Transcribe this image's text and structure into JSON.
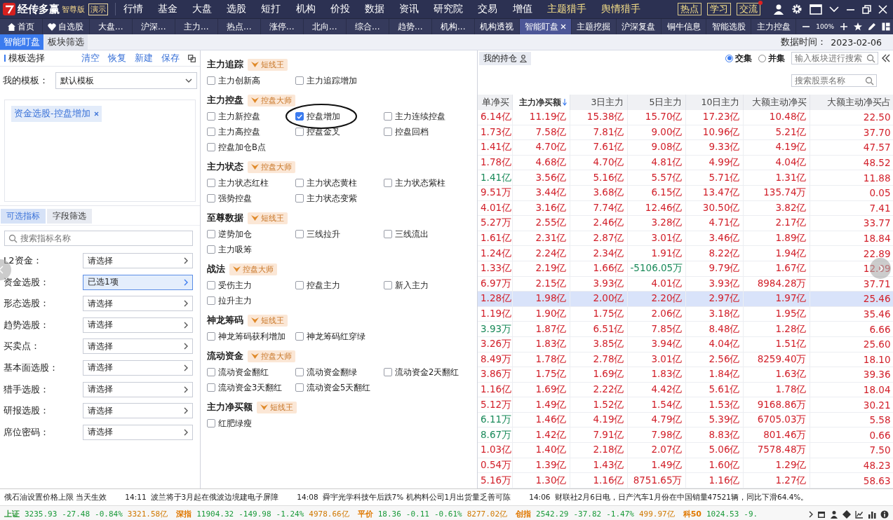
{
  "app": {
    "logo": "经传多赢",
    "edition": "智尊版",
    "demo": "演示"
  },
  "menu": [
    {
      "label": "行情",
      "featured": false
    },
    {
      "label": "基金",
      "featured": false
    },
    {
      "label": "大盘",
      "featured": false
    },
    {
      "label": "选股",
      "featured": false
    },
    {
      "label": "短打",
      "featured": false
    },
    {
      "label": "机构",
      "featured": false
    },
    {
      "label": "价投",
      "featured": false
    },
    {
      "label": "数据",
      "featured": false
    },
    {
      "label": "资讯",
      "featured": false
    },
    {
      "label": "研究院",
      "featured": false
    },
    {
      "label": "交易",
      "featured": false
    },
    {
      "label": "增值",
      "featured": false
    },
    {
      "label": "主题猎手",
      "featured": true
    },
    {
      "label": "舆情猎手",
      "featured": true
    }
  ],
  "top_buttons": [
    {
      "label": "热点",
      "notify": false
    },
    {
      "label": "学习",
      "notify": false
    },
    {
      "label": "交流",
      "notify": true
    }
  ],
  "tabs": [
    {
      "label": "首页",
      "kind": "home",
      "selected": false
    },
    {
      "label": "自选股",
      "kind": "heart",
      "selected": false
    },
    {
      "label": "大盘...",
      "kind": "plain",
      "selected": false
    },
    {
      "label": "沪深...",
      "kind": "plain",
      "selected": false
    },
    {
      "label": "主力...",
      "kind": "plain",
      "selected": false
    },
    {
      "label": "热点...",
      "kind": "plain",
      "selected": false
    },
    {
      "label": "涨停...",
      "kind": "plain",
      "selected": false
    },
    {
      "label": "北向...",
      "kind": "plain",
      "selected": false
    },
    {
      "label": "综合...",
      "kind": "plain",
      "selected": false
    },
    {
      "label": "趋势...",
      "kind": "plain",
      "selected": false
    },
    {
      "label": "机构...",
      "kind": "plain",
      "selected": false
    },
    {
      "label": "机构透视",
      "kind": "plain",
      "selected": false
    },
    {
      "label": "智能盯盘",
      "kind": "plain",
      "selected": true
    },
    {
      "label": "主题挖掘",
      "kind": "plain",
      "selected": false
    },
    {
      "label": "沪深复盘",
      "kind": "plain",
      "selected": false
    },
    {
      "label": "铜牛信息",
      "kind": "plain",
      "selected": false
    },
    {
      "label": "智能选股",
      "kind": "plain",
      "selected": false
    },
    {
      "label": "主力控盘",
      "kind": "plain",
      "selected": false
    }
  ],
  "zoom": "100%",
  "subtabs": [
    {
      "label": "智能盯盘",
      "selected": true
    },
    {
      "label": "板块筛选",
      "selected": false
    }
  ],
  "data_time": {
    "label": "数据时间：",
    "value": "2023-02-06"
  },
  "template": {
    "title": "模板选择",
    "actions": [
      "清空",
      "恢复",
      "新建",
      "保存"
    ],
    "my_label": "我的模板：",
    "my_value": "默认模板",
    "tags": [
      "资金选股-控盘增加"
    ]
  },
  "indicator_tabs": [
    {
      "label": "可选指标",
      "selected": true
    },
    {
      "label": "字段筛选",
      "selected": false
    }
  ],
  "indicator_search": {
    "placeholder": "搜索指标名称"
  },
  "filters": [
    {
      "label": "L2资金：",
      "value": "请选择",
      "active": false
    },
    {
      "label": "资金选股：",
      "value": "已选1项",
      "active": true
    },
    {
      "label": "形态选股：",
      "value": "请选择",
      "active": false
    },
    {
      "label": "趋势选股：",
      "value": "请选择",
      "active": false
    },
    {
      "label": "买卖点：",
      "value": "请选择",
      "active": false
    },
    {
      "label": "基本面选股：",
      "value": "请选择",
      "active": false
    },
    {
      "label": "猎手选股：",
      "value": "请选择",
      "active": false
    },
    {
      "label": "研报选股：",
      "value": "请选择",
      "active": false
    },
    {
      "label": "席位密码：",
      "value": "请选择",
      "active": false
    }
  ],
  "groups": [
    {
      "title": "主力追踪",
      "badge": "短线王",
      "options": [
        {
          "label": "主力创新高",
          "checked": false
        },
        {
          "label": "主力追踪增加",
          "checked": false
        }
      ]
    },
    {
      "title": "主力控盘",
      "badge": "控盘大师",
      "options": [
        {
          "label": "主力新控盘",
          "checked": false
        },
        {
          "label": "控盘增加",
          "checked": true
        },
        {
          "label": "主力连续控盘",
          "checked": false
        },
        {
          "label": "主力高控盘",
          "checked": false
        },
        {
          "label": "控盘金叉",
          "checked": false
        },
        {
          "label": "控盘回档",
          "checked": false
        },
        {
          "label": "控盘加仓B点",
          "checked": false
        }
      ]
    },
    {
      "title": "主力状态",
      "badge": "控盘大师",
      "options": [
        {
          "label": "主力状态红柱",
          "checked": false
        },
        {
          "label": "主力状态黄柱",
          "checked": false
        },
        {
          "label": "主力状态紫柱",
          "checked": false
        },
        {
          "label": "强势控盘",
          "checked": false
        },
        {
          "label": "主力状态变紫",
          "checked": false
        }
      ]
    },
    {
      "title": "至尊数据",
      "badge": "短线王",
      "options": [
        {
          "label": "逆势加仓",
          "checked": false
        },
        {
          "label": "三线拉升",
          "checked": false
        },
        {
          "label": "三线流出",
          "checked": false
        },
        {
          "label": "主力吸筹",
          "checked": false
        }
      ]
    },
    {
      "title": "战法",
      "badge": "控盘大师",
      "options": [
        {
          "label": "受伤主力",
          "checked": false
        },
        {
          "label": "控盘主力",
          "checked": false
        },
        {
          "label": "新入主力",
          "checked": false
        },
        {
          "label": "拉升主力",
          "checked": false
        }
      ]
    },
    {
      "title": "神龙筹码",
      "badge": "短线王",
      "options": [
        {
          "label": "神龙筹码获利增加",
          "checked": false
        },
        {
          "label": "神龙筹码红穿绿",
          "checked": false
        }
      ]
    },
    {
      "title": "流动资金",
      "badge": "控盘大师",
      "options": [
        {
          "label": "流动资金翻红",
          "checked": false
        },
        {
          "label": "流动资金翻绿",
          "checked": false
        },
        {
          "label": "流动资金2天翻红",
          "checked": false
        },
        {
          "label": "流动资金3天翻红",
          "checked": false
        },
        {
          "label": "流动资金5天翻红",
          "checked": false
        }
      ]
    },
    {
      "title": "主力净买额",
      "badge": "短线王",
      "options": [
        {
          "label": "红肥绿瘦",
          "checked": false
        }
      ]
    }
  ],
  "positions_tab": "我的持仓",
  "set_mode": [
    {
      "label": "交集",
      "selected": true
    },
    {
      "label": "并集",
      "selected": false
    }
  ],
  "sector_search": {
    "placeholder": "输入板块进行搜索"
  },
  "stock_search": {
    "placeholder": "搜索股票名称"
  },
  "table": {
    "columns": [
      {
        "label": "单净买",
        "sorted": false
      },
      {
        "label": "主力净买额",
        "sorted": true
      },
      {
        "label": "3日主力",
        "sorted": false
      },
      {
        "label": "5日主力",
        "sorted": false
      },
      {
        "label": "10日主力",
        "sorted": false
      },
      {
        "label": "大额主动净买",
        "sorted": false
      },
      {
        "label": "大额主动净买占",
        "sorted": false
      }
    ],
    "rows": [
      {
        "cells": [
          "6.14亿",
          "11.19亿",
          "15.38亿",
          "15.70亿",
          "17.23亿",
          "10.48亿",
          "22.50"
        ],
        "down": [
          false,
          false,
          false,
          false,
          false,
          false,
          false
        ],
        "selected": false
      },
      {
        "cells": [
          "1.73亿",
          "7.58亿",
          "7.81亿",
          "9.00亿",
          "10.96亿",
          "5.21亿",
          "37.70"
        ],
        "down": [
          false,
          false,
          false,
          false,
          false,
          false,
          false
        ],
        "selected": false
      },
      {
        "cells": [
          "1.41亿",
          "4.70亿",
          "7.61亿",
          "9.08亿",
          "9.33亿",
          "4.19亿",
          "47.57"
        ],
        "down": [
          false,
          false,
          false,
          false,
          false,
          false,
          false
        ],
        "selected": false
      },
      {
        "cells": [
          "1.78亿",
          "4.68亿",
          "4.70亿",
          "4.81亿",
          "4.99亿",
          "4.04亿",
          "48.52"
        ],
        "down": [
          false,
          false,
          false,
          false,
          false,
          false,
          false
        ],
        "selected": false
      },
      {
        "cells": [
          "1.41亿",
          "3.56亿",
          "5.16亿",
          "5.57亿",
          "5.71亿",
          "1.31亿",
          "11.88"
        ],
        "down": [
          true,
          false,
          false,
          false,
          false,
          false,
          false
        ],
        "selected": false
      },
      {
        "cells": [
          "9.51万",
          "3.44亿",
          "3.68亿",
          "6.15亿",
          "13.47亿",
          "135.74万",
          "0.05"
        ],
        "down": [
          false,
          false,
          false,
          false,
          false,
          false,
          false
        ],
        "selected": false
      },
      {
        "cells": [
          "4.01亿",
          "3.16亿",
          "7.74亿",
          "12.46亿",
          "30.50亿",
          "3.82亿",
          "7.41"
        ],
        "down": [
          false,
          false,
          false,
          false,
          false,
          false,
          false
        ],
        "selected": false
      },
      {
        "cells": [
          "5.27万",
          "2.55亿",
          "2.46亿",
          "3.28亿",
          "4.71亿",
          "2.17亿",
          "33.77"
        ],
        "down": [
          false,
          false,
          false,
          false,
          false,
          false,
          false
        ],
        "selected": false
      },
      {
        "cells": [
          "1.61亿",
          "2.31亿",
          "2.87亿",
          "3.01亿",
          "3.46亿",
          "1.89亿",
          "18.84"
        ],
        "down": [
          false,
          false,
          false,
          false,
          false,
          false,
          false
        ],
        "selected": false
      },
      {
        "cells": [
          "1.24亿",
          "2.24亿",
          "2.34亿",
          "1.91亿",
          "8.22亿",
          "1.94亿",
          "22.89"
        ],
        "down": [
          false,
          false,
          false,
          false,
          false,
          false,
          false
        ],
        "selected": false
      },
      {
        "cells": [
          "1.33亿",
          "2.19亿",
          "1.66亿",
          "-5106.05万",
          "9.79亿",
          "1.67亿",
          "12.09"
        ],
        "down": [
          false,
          false,
          false,
          true,
          false,
          false,
          false
        ],
        "selected": false
      },
      {
        "cells": [
          "6.97万",
          "2.15亿",
          "3.93亿",
          "4.01亿",
          "3.93亿",
          "8984.28万",
          "37.71"
        ],
        "down": [
          false,
          false,
          false,
          false,
          false,
          false,
          false
        ],
        "selected": false
      },
      {
        "cells": [
          "1.28亿",
          "1.98亿",
          "2.00亿",
          "2.20亿",
          "2.97亿",
          "1.97亿",
          "25.46"
        ],
        "down": [
          false,
          false,
          false,
          false,
          false,
          false,
          false
        ],
        "selected": true
      },
      {
        "cells": [
          "1.19亿",
          "1.90亿",
          "1.75亿",
          "2.06亿",
          "3.18亿",
          "1.95亿",
          "35.46"
        ],
        "down": [
          false,
          false,
          false,
          false,
          false,
          false,
          false
        ],
        "selected": false
      },
      {
        "cells": [
          "3.93万",
          "1.87亿",
          "6.51亿",
          "7.85亿",
          "8.48亿",
          "1.28亿",
          "6.66"
        ],
        "down": [
          true,
          false,
          false,
          false,
          false,
          false,
          false
        ],
        "selected": false
      },
      {
        "cells": [
          "3.26万",
          "1.83亿",
          "3.85亿",
          "3.94亿",
          "4.04亿",
          "1.51亿",
          "25.60"
        ],
        "down": [
          false,
          false,
          false,
          false,
          false,
          false,
          false
        ],
        "selected": false
      },
      {
        "cells": [
          "8.49万",
          "1.78亿",
          "2.78亿",
          "3.01亿",
          "2.56亿",
          "8259.40万",
          "18.10"
        ],
        "down": [
          false,
          false,
          false,
          false,
          false,
          false,
          false
        ],
        "selected": false
      },
      {
        "cells": [
          "3.86万",
          "1.75亿",
          "1.69亿",
          "1.83亿",
          "1.84亿",
          "1.63亿",
          "39.36"
        ],
        "down": [
          false,
          false,
          false,
          false,
          false,
          false,
          false
        ],
        "selected": false
      },
      {
        "cells": [
          "1.16亿",
          "1.69亿",
          "2.22亿",
          "4.42亿",
          "5.61亿",
          "1.78亿",
          "18.04"
        ],
        "down": [
          false,
          false,
          false,
          false,
          false,
          false,
          false
        ],
        "selected": false
      },
      {
        "cells": [
          "5.12万",
          "1.49亿",
          "1.52亿",
          "1.54亿",
          "1.53亿",
          "9168.86万",
          "30.21"
        ],
        "down": [
          false,
          false,
          false,
          false,
          false,
          false,
          false
        ],
        "selected": false
      },
      {
        "cells": [
          "6.11万",
          "1.46亿",
          "4.19亿",
          "4.79亿",
          "5.39亿",
          "6705.03万",
          "5.58"
        ],
        "down": [
          true,
          false,
          false,
          false,
          false,
          false,
          false
        ],
        "selected": false
      },
      {
        "cells": [
          "8.67万",
          "1.42亿",
          "7.91亿",
          "7.98亿",
          "8.83亿",
          "801.46万",
          "0.66"
        ],
        "down": [
          true,
          false,
          false,
          false,
          false,
          false,
          false
        ],
        "selected": false
      },
      {
        "cells": [
          "1.03亿",
          "1.40亿",
          "2.18亿",
          "2.07亿",
          "5.06亿",
          "7578.48万",
          "7.50"
        ],
        "down": [
          false,
          false,
          false,
          false,
          false,
          false,
          false
        ],
        "selected": false
      },
      {
        "cells": [
          "0.54万",
          "1.39亿",
          "1.43亿",
          "1.49亿",
          "1.60亿",
          "1.29亿",
          "48.23"
        ],
        "down": [
          false,
          false,
          false,
          false,
          false,
          false,
          false
        ],
        "selected": false
      },
      {
        "cells": [
          "5.16万",
          "1.30亿",
          "1.16亿",
          "8751.65万",
          "1.16亿",
          "1.27亿",
          "58.63"
        ],
        "down": [
          false,
          false,
          false,
          false,
          false,
          false,
          false
        ],
        "selected": false
      }
    ]
  },
  "news": [
    {
      "text": "俄石油设置价格上限 当天生效"
    },
    {
      "time": "14:11",
      "text": "波兰将于3月起在俄波边境建电子屏障"
    },
    {
      "time": "14:08",
      "text": "舜宇光学科技午后跌7% 机构料公司1月出货量乏善可陈"
    },
    {
      "time": "14:06",
      "text": "财联社2月6日电，日产汽车1月份在中国销量47521辆，同比下滑64.4%。"
    }
  ],
  "indices": [
    {
      "name": "上证",
      "color": "#2f9a3c",
      "price": "3235.93",
      "change": "-27.48",
      "pct": "-0.84%",
      "amount": "3321.58亿"
    },
    {
      "name": "深指",
      "color": "#e07800",
      "price": "11904.32",
      "change": "-149.98",
      "pct": "-1.24%",
      "amount": "4978.66亿"
    },
    {
      "name": "平价",
      "color": "#e07800",
      "price": "18.36",
      "change": "-0.11",
      "pct": "-0.61%",
      "amount": "8277.02亿"
    },
    {
      "name": "创指",
      "color": "#e07800",
      "price": "2542.29",
      "change": "-37.82",
      "pct": "-1.47%",
      "amount": "499.97亿"
    },
    {
      "name": "科50",
      "color": "#e07800",
      "price": "1024.53",
      "change": "-9."
    }
  ]
}
